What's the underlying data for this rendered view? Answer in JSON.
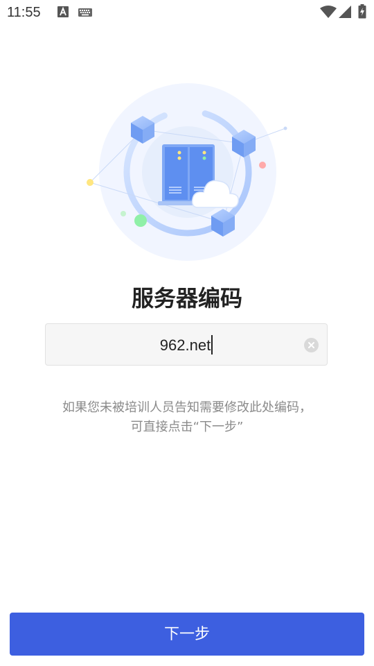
{
  "status_bar": {
    "time": "11:55",
    "icons": [
      "text-input-method-icon",
      "keyboard-icon",
      "wifi-icon",
      "cell-signal-icon",
      "battery-charging-icon"
    ]
  },
  "main": {
    "illustration": "server-cloud-illustration",
    "title": "服务器编码",
    "server_code": {
      "value": "962.net"
    },
    "hint_line1": "如果您未被培训人员告知需要修改此处编码，",
    "hint_line2": "可直接点击“下一步”"
  },
  "footer": {
    "next_label": "下一步"
  },
  "colors": {
    "primary": "#3d5fe0",
    "hint_text": "#8a8a8a",
    "input_bg": "#f6f6f6"
  }
}
